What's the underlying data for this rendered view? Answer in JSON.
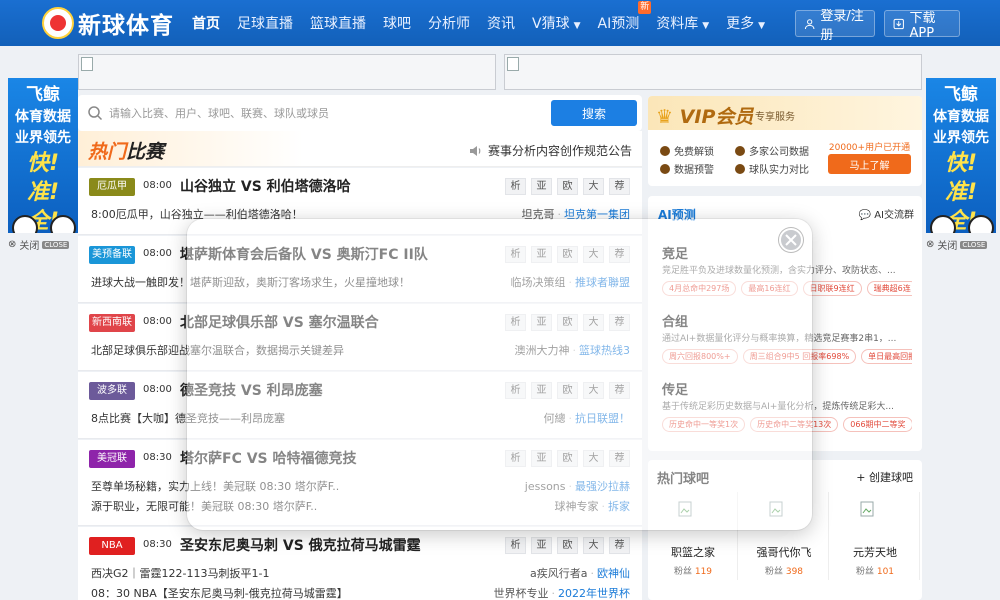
{
  "header": {
    "logo_text": "新球体育",
    "nav": [
      {
        "label": "首页",
        "active": true
      },
      {
        "label": "足球直播"
      },
      {
        "label": "篮球直播"
      },
      {
        "label": "球吧"
      },
      {
        "label": "分析师"
      },
      {
        "label": "资讯"
      },
      {
        "label": "V猜球",
        "dropdown": true
      },
      {
        "label": "AI预测",
        "badge": "新"
      },
      {
        "label": "资料库",
        "dropdown": true
      },
      {
        "label": "更多",
        "dropdown": true
      }
    ],
    "login_label": "登录/注册",
    "download_label": "下载APP",
    "colors": {
      "primary": "#1565c0",
      "accent": "#f06a1b"
    }
  },
  "side_ads": {
    "left": {
      "line1": "飞鲸",
      "line2": "体育数据",
      "line3": "业界领先",
      "slogan1": "快!",
      "slogan2": "准!",
      "slogan3": "全!"
    },
    "right": {
      "line1": "飞鲸",
      "line2": "体育数据",
      "line3": "业界领先",
      "slogan1": "快!",
      "slogan2": "准!",
      "slogan3": "全!"
    },
    "close_label": "关闭",
    "close_tag": "CLOSE"
  },
  "search": {
    "placeholder": "请输入比赛、用户、球吧、联赛、球队或球员",
    "button_label": "搜索"
  },
  "hot_matches": {
    "title_accent": "热门",
    "title_rest": "比赛",
    "notice": "赛事分析内容创作规范公告",
    "op_labels": [
      "析",
      "亚",
      "欧",
      "大",
      "荐"
    ],
    "matches": [
      {
        "league": "厄瓜甲",
        "league_color": "#8a8a1a",
        "time": "08:00",
        "title": "山谷独立 VS 利伯塔德洛哈",
        "lines": [
          {
            "text": "8:00厄瓜甲，山谷独立——利伯塔德洛哈！",
            "author": "坦克哥",
            "group": "坦克第一集团"
          }
        ]
      },
      {
        "league": "美预备联",
        "league_color": "#1a96d8",
        "time": "08:00",
        "title": "堪萨斯体育会后备队 VS 奥斯汀FC II队",
        "lines": [
          {
            "text": "进球大战一触即发！堪萨斯迎敌，奥斯汀客场求生，火星撞地球！",
            "author": "临场决策组",
            "group": "推球者聯盟"
          }
        ]
      },
      {
        "league": "新西南联",
        "league_color": "#e0454a",
        "time": "08:00",
        "title": "北部足球俱乐部 VS 塞尔温联合",
        "lines": [
          {
            "text": "北部足球俱乐部迎战塞尔温联合，数据揭示关键差异",
            "author": "澳洲大力神",
            "group": "篮球热线3"
          }
        ]
      },
      {
        "league": "波多联",
        "league_color": "#6c5a9a",
        "time": "08:00",
        "title": "德圣竞技 VS 利昂庞塞",
        "lines": [
          {
            "text": "8点比赛【大咖】德圣竞技——利昂庞塞",
            "author": "何總",
            "group": "抗日联盟！"
          }
        ]
      },
      {
        "league": "美冠联",
        "league_color": "#8e24aa",
        "time": "08:30",
        "title": "塔尔萨FC VS 哈特福德竞技",
        "lines": [
          {
            "text": "至尊单场秘籍，实力上线！美冠联 08:30 塔尔萨F..",
            "author": "jessons",
            "group": "最强沙拉赫"
          },
          {
            "text": "源于职业，无限可能！美冠联 08:30 塔尔萨F..",
            "author": "球神专家",
            "group": "拆家"
          }
        ]
      },
      {
        "league": "NBA",
        "league_color": "#e02020",
        "time": "08:30",
        "title": "圣安东尼奥马刺 VS 俄克拉荷马城雷霆",
        "lines": [
          {
            "text": "西决G2｜雷霆122-113马刺扳平1-1",
            "author": "a疾风行者a",
            "group": "欧神仙"
          },
          {
            "text": "08：30 NBA【圣安东尼奥马刺-俄克拉荷马城雷霆】",
            "author": "世界杯专业",
            "group": "2022年世界杯"
          }
        ]
      }
    ]
  },
  "vip": {
    "title": "VIP会员",
    "subtitle": "专享服务",
    "features": [
      "免费解锁",
      "多家公司数据",
      "数据预警",
      "球队实力对比"
    ],
    "user_count": "20000+用户已开通",
    "button_label": "马上了解"
  },
  "ai_predict": {
    "title": "AI预测",
    "link_label": "AI交流群",
    "items": [
      {
        "name": "竞足",
        "desc": "竞足胜平负及进球数量化预测，含实力评分、攻防状态、...",
        "tags": [
          "4月总命中297场",
          "最高16连红",
          "日职联9连红",
          "瑞典超6连"
        ]
      },
      {
        "name": "合组",
        "desc": "通过AI+数据量化评分与概率换算，精选竞足赛事2串1，...",
        "tags": [
          "周六回报800%+",
          "周三组合9中5 回报率698%",
          "单日最高回报"
        ]
      },
      {
        "name": "传足",
        "desc": "基于传统足彩历史数据与AI+量化分析，提炼传统足彩大...",
        "tags": [
          "历史命中一等奖1次",
          "历史命中二等奖13次",
          "066期中二等奖"
        ]
      }
    ]
  },
  "hot_bars": {
    "title": "热门球吧",
    "create_label": "+ 创建球吧",
    "fans_label": "粉丝",
    "items": [
      {
        "name": "职篮之家",
        "fans": "119"
      },
      {
        "name": "强哥代你飞",
        "fans": "398"
      },
      {
        "name": "元芳天地",
        "fans": "101"
      }
    ]
  }
}
